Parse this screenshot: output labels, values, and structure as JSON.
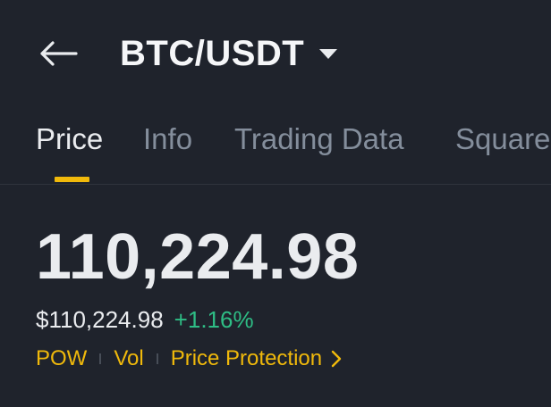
{
  "header": {
    "pair": "BTC/USDT"
  },
  "tabs": [
    {
      "label": "Price",
      "active": true
    },
    {
      "label": "Info",
      "active": false
    },
    {
      "label": "Trading Data",
      "active": false
    },
    {
      "label": "Square",
      "active": false
    }
  ],
  "price": {
    "last": "110,224.98",
    "usd": "$110,224.98",
    "change_pct": "+1.16%"
  },
  "tags": {
    "pow": "POW",
    "vol": "Vol",
    "protection": "Price Protection"
  },
  "colors": {
    "background": "#1f232c",
    "accent": "#f0b90b",
    "positive": "#2ebd85",
    "muted": "#848e9c"
  },
  "icons": {
    "back": "arrow-left-icon",
    "pair_menu": "caret-down-icon",
    "protection_more": "chevron-right-icon"
  }
}
